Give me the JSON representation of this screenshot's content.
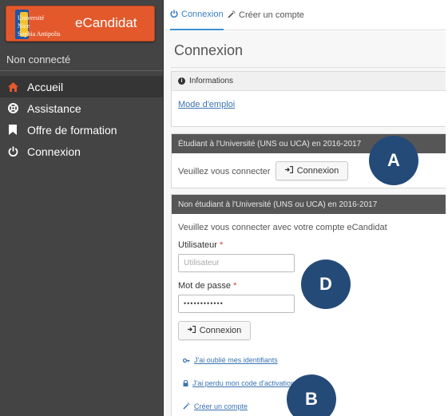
{
  "sidebar": {
    "brand": {
      "logo_text": [
        "Université",
        "Nice",
        "Sophia Antipolis"
      ],
      "name": "eCandidat"
    },
    "status": "Non connecté",
    "items": [
      {
        "label": "Accueil",
        "icon": "home-icon",
        "active": true
      },
      {
        "label": "Assistance",
        "icon": "lifebuoy-icon",
        "active": false
      },
      {
        "label": "Offre de formation",
        "icon": "bookmark-icon",
        "active": false
      },
      {
        "label": "Connexion",
        "icon": "power-icon",
        "active": false
      }
    ]
  },
  "tabs": [
    {
      "label": "Connexion",
      "icon": "power-icon",
      "active": true
    },
    {
      "label": "Créer un compte",
      "icon": "magic-wand-icon",
      "active": false
    }
  ],
  "main": {
    "title": "Connexion",
    "info_panel": {
      "header": "Informations",
      "link": "Mode d'emploi"
    },
    "student_panel": {
      "header": "Étudiant à l'Université (UNS ou UCA) en 2016-2017",
      "text": "Veuillez vous connecter",
      "button": "Connexion"
    },
    "nonstudent_panel": {
      "header": "Non étudiant à l'Université (UNS ou UCA) en 2016-2017",
      "text": "Veuillez vous connecter avec votre compte eCandidat",
      "user_label": "Utilisateur",
      "user_placeholder": "Utilisateur",
      "password_label": "Mot de passe",
      "password_value": "••••••••••••",
      "required_mark": "*",
      "button": "Connexion",
      "links": [
        "J'ai oublié mes identifiants",
        "J'ai perdu mon code d'activation",
        "Créer un compte"
      ]
    }
  },
  "badges": [
    "A",
    "D",
    "B"
  ],
  "colors": {
    "sidebar_bg": "#444444",
    "brand_bg": "#e3592c",
    "accent": "#3b8fd1",
    "badge_bg": "#244a78",
    "panel_dark": "#565656"
  }
}
